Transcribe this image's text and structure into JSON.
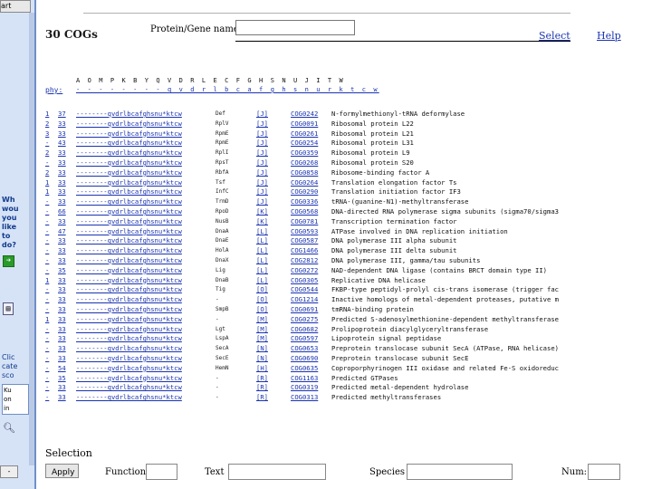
{
  "sidebar": {
    "top_tab": "art",
    "help_lines": [
      "Wh",
      "wou",
      "you",
      "like",
      "to",
      "do?"
    ],
    "go_icon": "go-arrow-icon",
    "more_lines": [
      "Clic",
      "cate",
      "sco"
    ],
    "box_lines": [
      "Ku",
      "on",
      "in"
    ],
    "bottom_tab": "-"
  },
  "header": {
    "title": "30 COGs",
    "gene_label": "Protein/Gene name:",
    "gene_value": "",
    "select_link": "Select",
    "help_link": "Help"
  },
  "categories": {
    "header_letters": "A O M P K B Y Q V D R L E C F G H S N U J I T W",
    "phy_label": "phy:",
    "phy_links": "- - - - - - - - q v d r l b c a f g h s n u r k t c w"
  },
  "cogs": [
    {
      "idx": "1",
      "count": "37",
      "pattern": "--------qvdrlbcafghsnu*ktcw",
      "gene": "Def",
      "cat": "[J]",
      "id": "COG0242",
      "desc": "N-formylmethionyl-tRNA deformylase"
    },
    {
      "idx": "2",
      "count": "33",
      "pattern": "--------qvdrlbcafghsnu*ktcw",
      "gene": "RplV",
      "cat": "[J]",
      "id": "COG0091",
      "desc": "Ribosomal protein L22"
    },
    {
      "idx": "3",
      "count": "33",
      "pattern": "--------qvdrlbcafghsnu*ktcw",
      "gene": "RpmE",
      "cat": "[J]",
      "id": "COG0261",
      "desc": "Ribosomal protein L21"
    },
    {
      "idx": "-",
      "count": "43",
      "pattern": "--------qvdrlbcafghsnu*ktcw",
      "gene": "RpmE",
      "cat": "[J]",
      "id": "COG0254",
      "desc": "Ribosomal protein L31"
    },
    {
      "idx": "2",
      "count": "33",
      "pattern": "--------qvdrlbcafghsnu*ktcw",
      "gene": "RplI",
      "cat": "[J]",
      "id": "COG0359",
      "desc": "Ribosomal protein L9"
    },
    {
      "idx": "-",
      "count": "33",
      "pattern": "--------qvdrlbcafghsnu*ktcw",
      "gene": "RpsT",
      "cat": "[J]",
      "id": "COG0268",
      "desc": "Ribosomal protein S20"
    },
    {
      "idx": "2",
      "count": "33",
      "pattern": "--------qvdrlbcafghsnu*ktcw",
      "gene": "RbfA",
      "cat": "[J]",
      "id": "COG0858",
      "desc": "Ribosome-binding factor A"
    },
    {
      "idx": "1",
      "count": "33",
      "pattern": "--------qvdrlbcafghsnu*ktcw",
      "gene": "Tsf",
      "cat": "[J]",
      "id": "COG0264",
      "desc": "Translation elongation factor Ts"
    },
    {
      "idx": "1",
      "count": "33",
      "pattern": "--------qvdrlbcafghsnu*ktcw",
      "gene": "InfC",
      "cat": "[J]",
      "id": "COG0290",
      "desc": "Translation initiation factor IF3"
    },
    {
      "idx": "-",
      "count": "33",
      "pattern": "--------qvdrlbcafghsnu*ktcw",
      "gene": "TrmD",
      "cat": "[J]",
      "id": "COG0336",
      "desc": "tRNA-(guanine-N1)-methyltransferase"
    },
    {
      "idx": "-",
      "count": "66",
      "pattern": "--------qvdrlbcafghsnu*ktcw",
      "gene": "RpoD",
      "cat": "[K]",
      "id": "COG0568",
      "desc": "DNA-directed RNA polymerase sigma subunits (sigma70/sigma3"
    },
    {
      "idx": "-",
      "count": "33",
      "pattern": "--------qvdrlbcafghsnu*ktcw",
      "gene": "NusB",
      "cat": "[K]",
      "id": "COG0781",
      "desc": "Transcription termination factor"
    },
    {
      "idx": "-",
      "count": "47",
      "pattern": "--------qvdrlbcafghsnu*ktcw",
      "gene": "DnaA",
      "cat": "[L]",
      "id": "COG0593",
      "desc": "ATPase involved in DNA replication initiation"
    },
    {
      "idx": "-",
      "count": "33",
      "pattern": "--------qvdrlbcafghsnu*ktcw",
      "gene": "DnaE",
      "cat": "[L]",
      "id": "COG0587",
      "desc": "DNA polymerase III alpha subunit"
    },
    {
      "idx": "-",
      "count": "33",
      "pattern": "--------qvdrlbcafghsnu*ktcw",
      "gene": "HolA",
      "cat": "[L]",
      "id": "COG1466",
      "desc": "DNA polymerase III delta subunit"
    },
    {
      "idx": "-",
      "count": "33",
      "pattern": "--------qvdrlbcafghsnu*ktcw",
      "gene": "DnaX",
      "cat": "[L]",
      "id": "COG2812",
      "desc": "DNA polymerase III, gamma/tau subunits"
    },
    {
      "idx": "-",
      "count": "35",
      "pattern": "--------qvdrlbcafghsnu*ktcw",
      "gene": "Lig",
      "cat": "[L]",
      "id": "COG0272",
      "desc": "NAD-dependent DNA ligase (contains BRCT domain type II)"
    },
    {
      "idx": "1",
      "count": "33",
      "pattern": "--------qvdrlbcafghsnu*ktcw",
      "gene": "DnaB",
      "cat": "[L]",
      "id": "COG0305",
      "desc": "Replicative DNA helicase"
    },
    {
      "idx": "-",
      "count": "33",
      "pattern": "--------qvdrlbcafghsnu*ktcw",
      "gene": "Tig",
      "cat": "[O]",
      "id": "COG0544",
      "desc": "FKBP-type peptidyl-prolyl cis-trans isomerase (trigger fac"
    },
    {
      "idx": "-",
      "count": "33",
      "pattern": "--------qvdrlbcafghsnu*ktcw",
      "gene": "-",
      "cat": "[O]",
      "id": "COG1214",
      "desc": "Inactive homologs of metal-dependent proteases, putative m"
    },
    {
      "idx": "-",
      "count": "33",
      "pattern": "--------qvdrlbcafghsnu*ktcw",
      "gene": "SmpB",
      "cat": "[O]",
      "id": "COG0691",
      "desc": "tmRNA-binding protein"
    },
    {
      "idx": "1",
      "count": "33",
      "pattern": "--------qvdrlbcafghsnu*ktcw",
      "gene": "-",
      "cat": "[M]",
      "id": "COG0275",
      "desc": "Predicted S-adenosylmethionine-dependent methyltransferase"
    },
    {
      "idx": "-",
      "count": "33",
      "pattern": "--------qvdrlbcafghsnu*ktcw",
      "gene": "Lgt",
      "cat": "[M]",
      "id": "COG0682",
      "desc": "Prolipoprotein diacylglyceryltransferase"
    },
    {
      "idx": "-",
      "count": "33",
      "pattern": "--------qvdrlbcafghsnu*ktcw",
      "gene": "LspA",
      "cat": "[M]",
      "id": "COG0597",
      "desc": "Lipoprotein signal peptidase"
    },
    {
      "idx": "-",
      "count": "33",
      "pattern": "--------qvdrlbcafghsnu*ktcw",
      "gene": "SecA",
      "cat": "[N]",
      "id": "COG0653",
      "desc": "Preprotein translocase subunit SecA (ATPase, RNA helicase)"
    },
    {
      "idx": "-",
      "count": "33",
      "pattern": "--------qvdrlbcafghsnu*ktcw",
      "gene": "SecE",
      "cat": "[N]",
      "id": "COG0690",
      "desc": "Preprotein translocase subunit SecE"
    },
    {
      "idx": "-",
      "count": "54",
      "pattern": "--------qvdrlbcafghsnu*ktcw",
      "gene": "HemN",
      "cat": "[H]",
      "id": "COG0635",
      "desc": "Coproporphyrinogen III oxidase and related Fe-S oxidoreduc"
    },
    {
      "idx": "-",
      "count": "35",
      "pattern": "--------qvdrlbcafghsnu*ktcw",
      "gene": "-",
      "cat": "[R]",
      "id": "COG1163",
      "desc": "Predicted GTPases"
    },
    {
      "idx": "-",
      "count": "33",
      "pattern": "--------qvdrlbcafghsnu*ktcw",
      "gene": "-",
      "cat": "[R]",
      "id": "COG0319",
      "desc": "Predicted metal-dependent hydrolase"
    },
    {
      "idx": "-",
      "count": "33",
      "pattern": "--------qvdrlbcafghsnu*ktcw",
      "gene": "-",
      "cat": "[R]",
      "id": "COG0313",
      "desc": "Predicted methyltransferases"
    }
  ],
  "selection": {
    "title": "Selection",
    "apply_label": "Apply",
    "function_label": "Function",
    "text_label": "Text",
    "species_label": "Species",
    "num_label": "Num:"
  }
}
